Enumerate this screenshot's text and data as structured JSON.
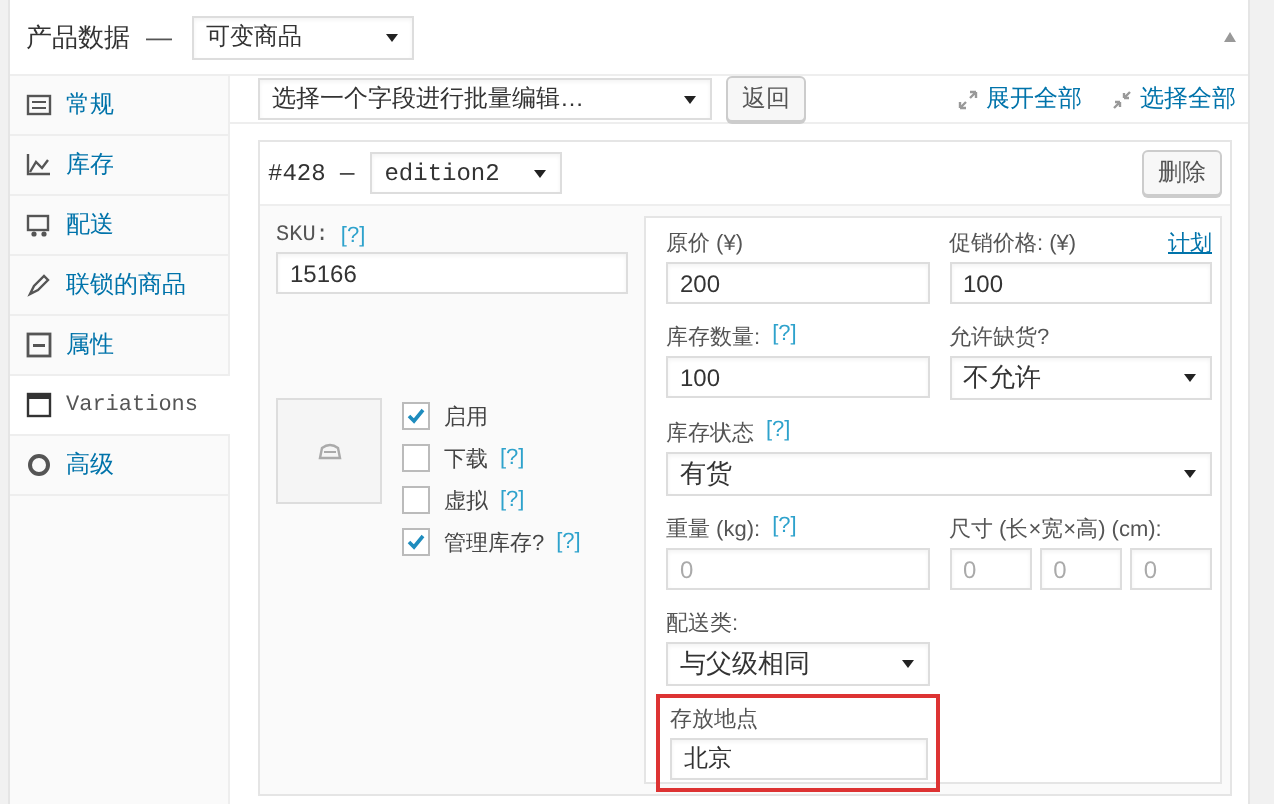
{
  "header": {
    "title": "产品数据",
    "dash": "—",
    "product_type": "可变商品",
    "collapsed": false
  },
  "sidebar": {
    "items": [
      {
        "label": "常规",
        "selected": false
      },
      {
        "label": "库存",
        "selected": false
      },
      {
        "label": "配送",
        "selected": false
      },
      {
        "label": "联锁的商品",
        "selected": false
      },
      {
        "label": "属性",
        "selected": false
      },
      {
        "label": "Variations",
        "selected": true
      },
      {
        "label": "高级",
        "selected": false
      }
    ]
  },
  "toolbar": {
    "bulk_edit": "选择一个字段进行批量编辑…",
    "go_button": "返回",
    "links": [
      "展开全部",
      "选择全部"
    ]
  },
  "variation": {
    "id": "#428",
    "dash": "—",
    "attribute": "edition2",
    "remove_button": "删除",
    "sku_label": "SKU:",
    "sku_help": "[?]",
    "sku": "15166",
    "options": [
      {
        "label": "启用",
        "checked": true
      },
      {
        "label": "下载",
        "checked": false,
        "help": "[?]"
      },
      {
        "label": "虚拟",
        "checked": false,
        "help": "[?]"
      },
      {
        "label": "管理库存?",
        "checked": true,
        "help": "[?]"
      }
    ],
    "rows": [
      [
        {
          "kind": "input",
          "label": "原价 (¥)",
          "value": "200"
        },
        {
          "kind": "input",
          "label": "促销价格: (¥)",
          "link": "计划",
          "value": "100"
        }
      ],
      [
        {
          "kind": "input",
          "label": "库存数量:",
          "help": "[?]",
          "value": "100"
        },
        {
          "kind": "select",
          "label": "允许缺货?",
          "value": "不允许"
        }
      ],
      [
        {
          "kind": "wide-select",
          "label": "库存状态",
          "help": "[?]",
          "value": "有货"
        }
      ],
      [
        {
          "kind": "input",
          "label": "重量 (kg):",
          "help": "[?]",
          "placeholder": "0"
        },
        {
          "kind": "dims",
          "label": "尺寸 (长×宽×高) (cm):",
          "placeholders": [
            "0",
            "0",
            "0"
          ]
        }
      ],
      [
        {
          "kind": "select",
          "label": "配送类:",
          "value": "与父级相同"
        }
      ],
      [
        {
          "kind": "input",
          "label": "存放地点",
          "value": "北京",
          "highlighted": true
        }
      ]
    ]
  }
}
